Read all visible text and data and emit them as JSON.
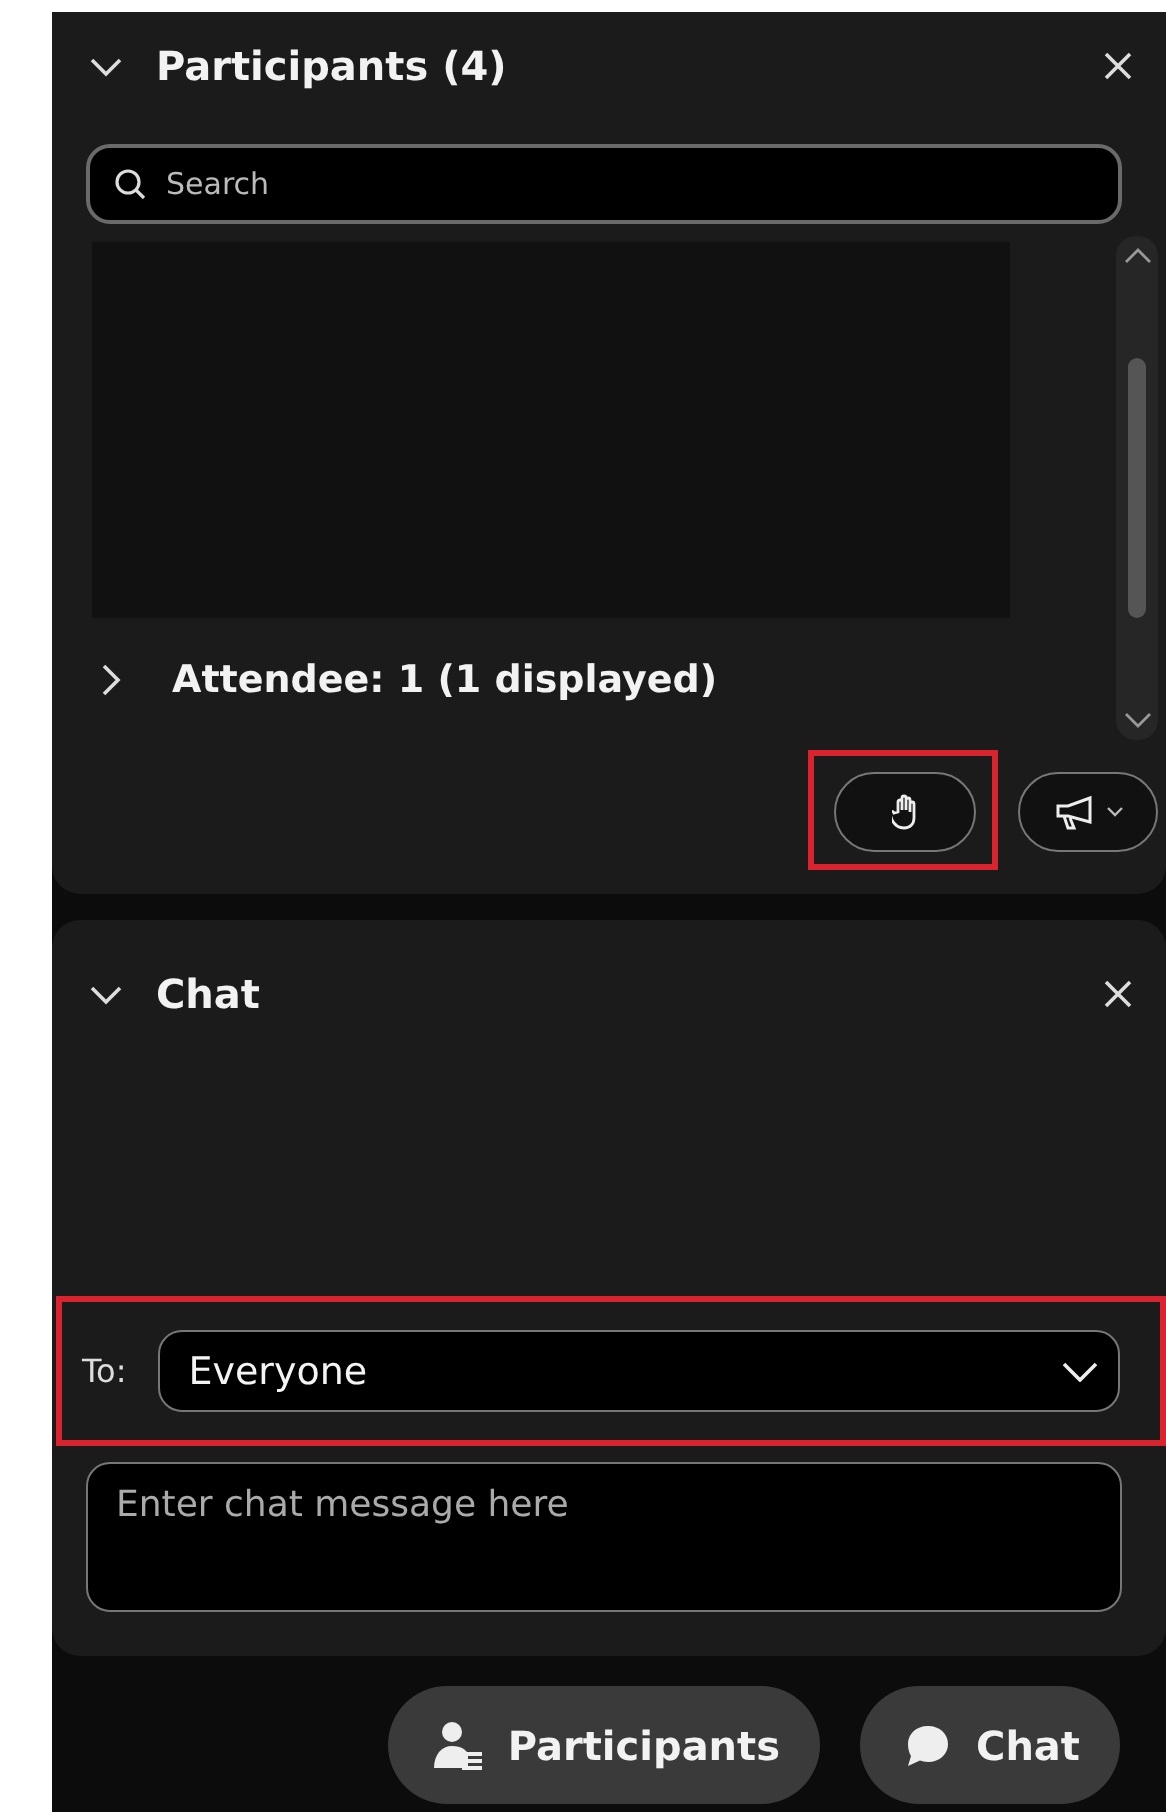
{
  "participants_panel": {
    "title": "Participants (4)",
    "expanded": true,
    "search": {
      "placeholder": "Search"
    },
    "groups": [
      {
        "label": "Attendee: 1 (1 displayed)",
        "expanded": false
      }
    ]
  },
  "chat_panel": {
    "title": "Chat",
    "expanded": true,
    "to_label": "To:",
    "recipient": "Everyone",
    "message": {
      "placeholder": "Enter chat message here"
    }
  },
  "bottom_buttons": [
    {
      "label": "Participants",
      "kind": "participants"
    },
    {
      "label": "Chat",
      "kind": "chat"
    }
  ]
}
